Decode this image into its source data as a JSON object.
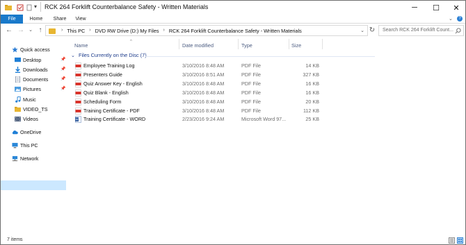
{
  "window": {
    "title": "RCK 264 Forklift Counterbalance Safety - Written Materials",
    "minimize_glyph": "─",
    "maximize_glyph": "☐",
    "close_glyph": "✕"
  },
  "ribbon": {
    "tabs": [
      "File",
      "Home",
      "Share",
      "View"
    ]
  },
  "address": {
    "crumbs": [
      "This PC",
      "DVD RW Drive (D:) My Files",
      "RCK 264 Forklift Counterbalance Safety - Written Materials"
    ],
    "search_placeholder": "Search RCK 264 Forklift Count..."
  },
  "nav": {
    "quick_access": "Quick access",
    "items": [
      "Desktop",
      "Downloads",
      "Documents",
      "Pictures",
      "Music",
      "VIDEO_TS",
      "Videos"
    ],
    "onedrive": "OneDrive",
    "this_pc": "This PC",
    "network": "Network"
  },
  "columns": {
    "name": "Name",
    "date": "Date modified",
    "type": "Type",
    "size": "Size"
  },
  "group": {
    "label": "Files Currently on the Disc (7)"
  },
  "files": [
    {
      "name": "Employee Training Log",
      "date": "3/10/2016 8:48 AM",
      "type": "PDF File",
      "size": "14 KB",
      "kind": "pdf"
    },
    {
      "name": "Presenters Guide",
      "date": "3/10/2016 8:51 AM",
      "type": "PDF File",
      "size": "327 KB",
      "kind": "pdf"
    },
    {
      "name": "Quiz Answer Key - English",
      "date": "3/10/2016 8:48 AM",
      "type": "PDF File",
      "size": "16 KB",
      "kind": "pdf"
    },
    {
      "name": "Quiz Blank - English",
      "date": "3/10/2016 8:48 AM",
      "type": "PDF File",
      "size": "16 KB",
      "kind": "pdf"
    },
    {
      "name": "Scheduling Form",
      "date": "3/10/2016 8:48 AM",
      "type": "PDF File",
      "size": "20 KB",
      "kind": "pdf"
    },
    {
      "name": "Training Certificate - PDF",
      "date": "3/10/2016 8:48 AM",
      "type": "PDF File",
      "size": "112 KB",
      "kind": "pdf"
    },
    {
      "name": "Training Certificate - WORD",
      "date": "2/23/2016 9:24 AM",
      "type": "Microsoft Word 97...",
      "size": "25 KB",
      "kind": "word"
    }
  ],
  "status": {
    "count": "7 items"
  },
  "colors": {
    "accent": "#1979ca",
    "selection": "#cce8ff",
    "folder": "#e8b632",
    "pdf": "#d9342b",
    "word": "#2b579a"
  }
}
